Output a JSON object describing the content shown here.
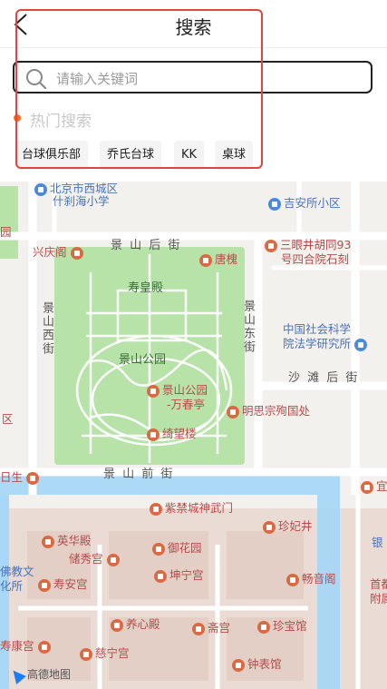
{
  "header": {
    "title": "搜索",
    "back_icon": "chevron-left-icon"
  },
  "search": {
    "placeholder": "请输入关键词",
    "value": ""
  },
  "hot": {
    "title": "热门搜索",
    "tags": [
      "台球俱乐部",
      "乔氏台球",
      "KK",
      "桌球"
    ]
  },
  "map": {
    "streets": {
      "jingshan_hou": "景 山 后 街",
      "jingshan_qian": "景 山 前 街",
      "shatan_hou": "沙 滩 后 街",
      "jingshan_xi": "景山西街",
      "jingshan_dong": "景山东街"
    },
    "park_labels": {
      "shouhuang": "寿皇殿",
      "jingshan_park": "景山公园",
      "wanchun_1": "景山公园",
      "wanchun_2": "-万春亭",
      "qiwang": "绮望楼"
    },
    "pois": {
      "school_1": "北京市西城区",
      "school_2": "什刹海小学",
      "jianan": "吉安所小区",
      "xingqing": "兴庆阁",
      "tanghuai": "唐槐",
      "sanyan_1": "三眼井胡同93",
      "sanyan_2": "号四合院石刻",
      "cass_1": "中国社会科学",
      "cass_2": "院法学研究所",
      "mingsi": "明思宗殉国处",
      "qu": "区",
      "yuan": "园",
      "risheng": "日生",
      "shenwumen": "紫禁城神武门",
      "zhenfei": "珍妃井",
      "yinghua": "英华殿",
      "chuxiu": "储秀宫",
      "yuhuayuan": "御花园",
      "foji_1": "佛教文",
      "foji_2": "化所",
      "shouan": "寿安宫",
      "kunning": "坤宁宫",
      "changyin": "畅音阁",
      "yangxin": "养心殿",
      "zhai": "斋宫",
      "zhenbao": "珍宝馆",
      "zhongbiao": "钟表馆",
      "cining": "慈宁宫",
      "shoukang": "寿康宫",
      "shouzheng_1": "首都",
      "shouzheng_2": "附属",
      "yin": "银",
      "yi": "宜"
    },
    "logo": "高德地图"
  },
  "colors": {
    "accent": "#ff6a1a",
    "highlight": "#e0463b",
    "park": "#b7e2a8",
    "water": "#a8d7f7",
    "palace": "#eadbd4"
  }
}
